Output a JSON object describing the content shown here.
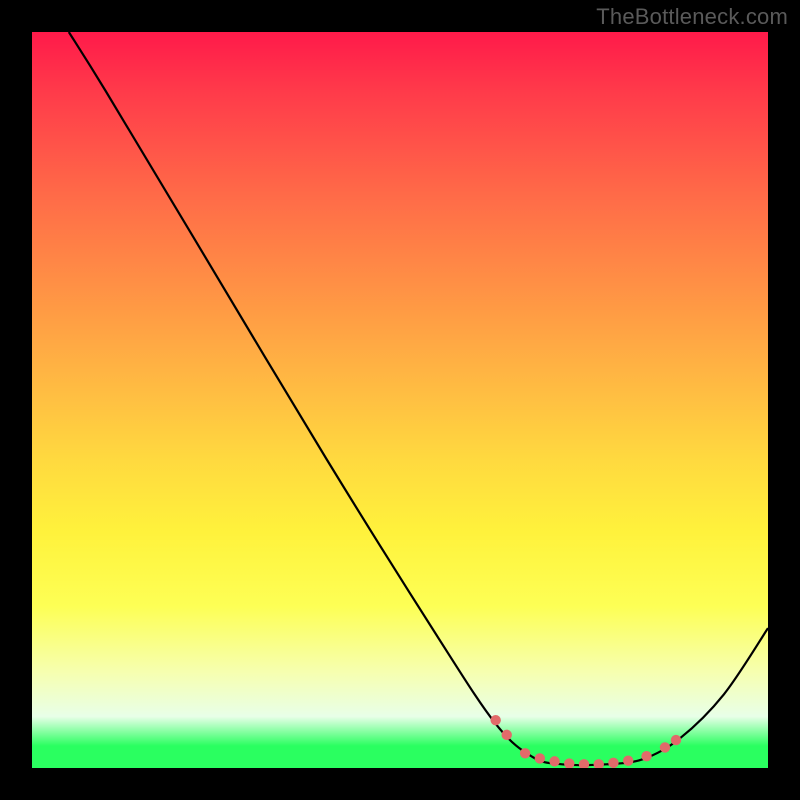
{
  "watermark": "TheBottleneck.com",
  "chart_data": {
    "type": "line",
    "title": "",
    "xlabel": "",
    "ylabel": "",
    "xlim": [
      0,
      100
    ],
    "ylim": [
      0,
      100
    ],
    "series": [
      {
        "name": "curve",
        "color": "#000000",
        "points": [
          {
            "x": 5,
            "y": 100
          },
          {
            "x": 10,
            "y": 92
          },
          {
            "x": 22,
            "y": 72
          },
          {
            "x": 40,
            "y": 42
          },
          {
            "x": 55,
            "y": 18
          },
          {
            "x": 63,
            "y": 6
          },
          {
            "x": 68,
            "y": 1.5
          },
          {
            "x": 72,
            "y": 0.5
          },
          {
            "x": 78,
            "y": 0.5
          },
          {
            "x": 83,
            "y": 1.2
          },
          {
            "x": 88,
            "y": 4
          },
          {
            "x": 94,
            "y": 10
          },
          {
            "x": 100,
            "y": 19
          }
        ]
      }
    ],
    "markers": [
      {
        "x": 63,
        "y": 6.5
      },
      {
        "x": 64.5,
        "y": 4.5
      },
      {
        "x": 67,
        "y": 2.0
      },
      {
        "x": 69,
        "y": 1.3
      },
      {
        "x": 71,
        "y": 0.9
      },
      {
        "x": 73,
        "y": 0.6
      },
      {
        "x": 75,
        "y": 0.5
      },
      {
        "x": 77,
        "y": 0.5
      },
      {
        "x": 79,
        "y": 0.7
      },
      {
        "x": 81,
        "y": 1.0
      },
      {
        "x": 83.5,
        "y": 1.6
      },
      {
        "x": 86,
        "y": 2.8
      },
      {
        "x": 87.5,
        "y": 3.8
      }
    ],
    "marker_color": "#e26a6a"
  }
}
